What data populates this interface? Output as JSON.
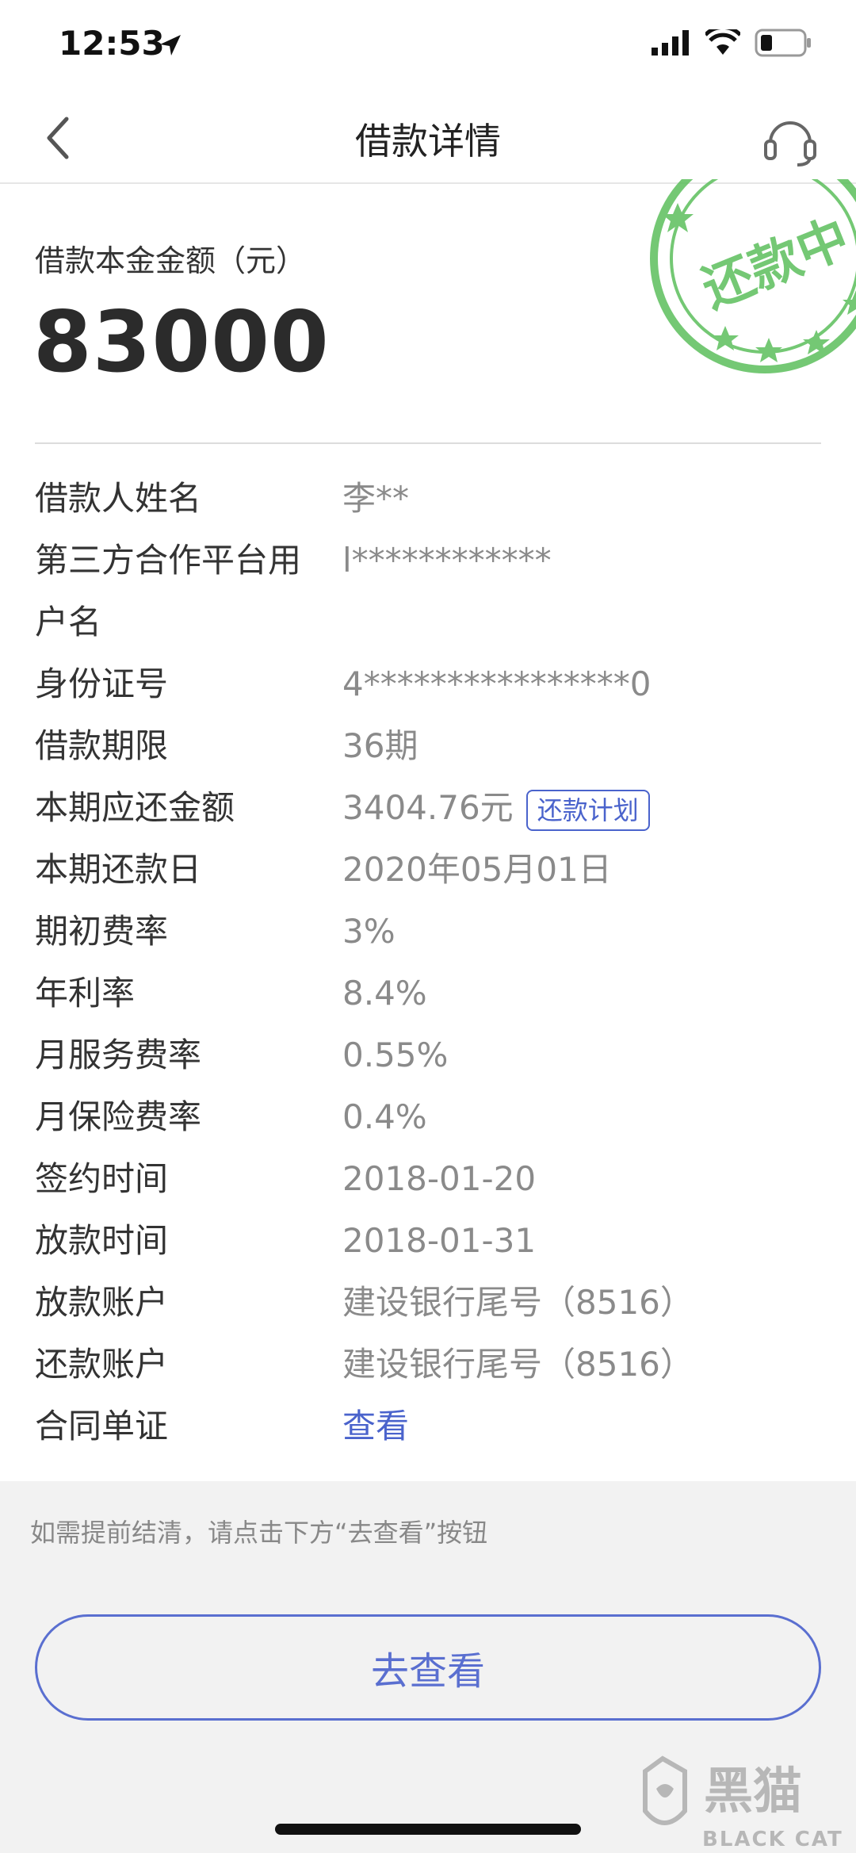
{
  "status_bar": {
    "time": "12:53"
  },
  "nav": {
    "title": "借款详情",
    "back_icon": "chevron-left-icon",
    "service_icon": "headset-icon"
  },
  "principal": {
    "label": "借款本金金额（元）",
    "amount": "83000"
  },
  "stamp": {
    "text": "还款中",
    "color": "#5cbf5c"
  },
  "details": [
    {
      "label": "借款人姓名",
      "value": "李**"
    },
    {
      "label": "第三方合作平台用户名",
      "value": "l************"
    },
    {
      "label": "身份证号",
      "value": "4****************0"
    },
    {
      "label": "借款期限",
      "value": "36期"
    },
    {
      "label": "本期应还金额",
      "value": "3404.76元",
      "tag": "还款计划"
    },
    {
      "label": "本期还款日",
      "value": "2020年05月01日"
    },
    {
      "label": "期初费率",
      "value": "3%"
    },
    {
      "label": "年利率",
      "value": "8.4%"
    },
    {
      "label": "月服务费率",
      "value": "0.55%"
    },
    {
      "label": "月保险费率",
      "value": "0.4%"
    },
    {
      "label": "签约时间",
      "value": "2018-01-20"
    },
    {
      "label": "放款时间",
      "value": "2018-01-31"
    },
    {
      "label": "放款账户",
      "value": "建设银行尾号（8516）"
    },
    {
      "label": "还款账户",
      "value": "建设银行尾号（8516）"
    },
    {
      "label": "合同单证",
      "value": "查看",
      "is_link": true
    }
  ],
  "footer": {
    "hint": "如需提前结清，请点击下方“去查看”按钮",
    "button_label": "去查看"
  },
  "watermark": {
    "text_cn": "黑猫",
    "text_en": "BLACK CAT"
  },
  "colors": {
    "accent": "#4a63cc",
    "stamp": "#5cbf5c",
    "muted_value": "#8a8a8a"
  }
}
